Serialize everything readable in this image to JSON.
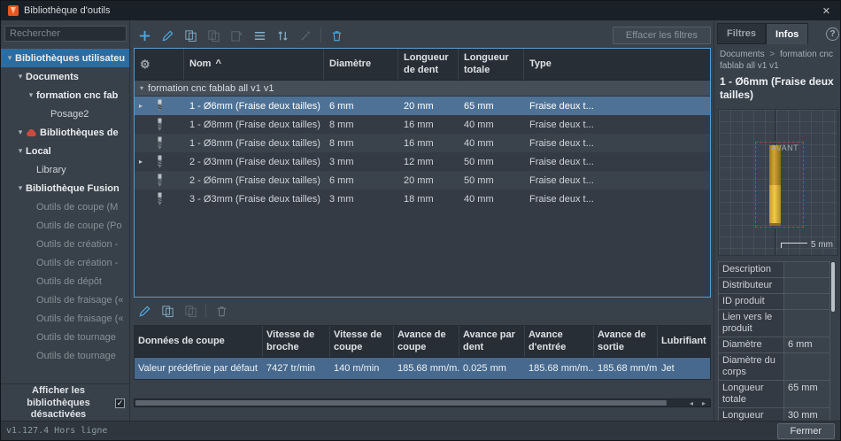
{
  "window": {
    "title": "Bibliothèque d'outils",
    "version": "v1.127.4 Hors ligne",
    "close_button": "Fermer"
  },
  "glyphs": {
    "close": "✕",
    "chevron_down": "▾",
    "chevron_right": "▸",
    "caret_up": "^",
    "gear": "⚙",
    "check": "✓",
    "arrow_left": "◂",
    "arrow_right": "▸",
    "help": "?"
  },
  "colors": {
    "accent_blue": "#4fa8e0",
    "selection_blue": "#4e7296",
    "tree_selection": "#2a6da3",
    "error_red": "#cf4a3e",
    "tool_gold": "#e8bf45",
    "brand_orange": "#e8561e"
  },
  "sidebar": {
    "search_placeholder": "Rechercher",
    "tree": [
      {
        "label": "Bibliothèques utilisateu"
      },
      {
        "label": "Documents"
      },
      {
        "label": "formation cnc fab"
      },
      {
        "label": "Posage2"
      },
      {
        "label": "Bibliothèques de"
      },
      {
        "label": "Local"
      },
      {
        "label": "Library"
      },
      {
        "label": "Bibliothèque Fusion"
      },
      {
        "label": "Outils de coupe (M"
      },
      {
        "label": "Outils de coupe (Po"
      },
      {
        "label": "Outils de création -"
      },
      {
        "label": "Outils de création -"
      },
      {
        "label": "Outils de dépôt"
      },
      {
        "label": "Outils de fraisage («"
      },
      {
        "label": "Outils de fraisage («"
      },
      {
        "label": "Outils de tournage"
      },
      {
        "label": "Outils de tournage"
      }
    ],
    "footer_label": "Afficher les bibliothèques désactivées"
  },
  "toolbar": {
    "clear_filters_label": "Effacer les filtres"
  },
  "tool_table": {
    "columns": {
      "name": "Nom",
      "diameter": "Diamètre",
      "flute_length": "Longueur de dent",
      "overall_length": "Longueur totale",
      "type": "Type"
    },
    "group_label": "formation cnc fablab all v1 v1",
    "rows": [
      {
        "name": "1 - Ø6mm (Fraise deux tailles)",
        "diameter": "6 mm",
        "flute_length": "20 mm",
        "overall_length": "65 mm",
        "type": "Fraise deux t..."
      },
      {
        "name": "1 - Ø8mm (Fraise deux tailles)",
        "diameter": "8 mm",
        "flute_length": "16 mm",
        "overall_length": "40 mm",
        "type": "Fraise deux t..."
      },
      {
        "name": "1 - Ø8mm (Fraise deux tailles)",
        "diameter": "8 mm",
        "flute_length": "16 mm",
        "overall_length": "40 mm",
        "type": "Fraise deux t..."
      },
      {
        "name": "2 - Ø3mm (Fraise deux tailles)",
        "diameter": "3 mm",
        "flute_length": "12 mm",
        "overall_length": "50 mm",
        "type": "Fraise deux t..."
      },
      {
        "name": "2 - Ø6mm (Fraise deux tailles)",
        "diameter": "6 mm",
        "flute_length": "20 mm",
        "overall_length": "50 mm",
        "type": "Fraise deux t..."
      },
      {
        "name": "3 - Ø3mm (Fraise deux tailles)",
        "diameter": "3 mm",
        "flute_length": "18 mm",
        "overall_length": "40 mm",
        "type": "Fraise deux t..."
      }
    ]
  },
  "cut_table": {
    "columns": {
      "preset": "Données de coupe",
      "spindle_speed": "Vitesse de broche",
      "cutting_speed": "Vitesse de coupe",
      "cutting_feed": "Avance de coupe",
      "feed_per_tooth": "Avance par dent",
      "lead_in_feed": "Avance d'entrée",
      "lead_out_feed": "Avance de sortie",
      "coolant": "Lubrifiant"
    },
    "rows": [
      {
        "preset": "Valeur prédéfinie par défaut",
        "spindle_speed": "7427 tr/min",
        "cutting_speed": "140 m/min",
        "cutting_feed": "185.68 mm/m...",
        "feed_per_tooth": "0.025 mm",
        "lead_in_feed": "185.68 mm/m...",
        "lead_out_feed": "185.68 mm/m...",
        "coolant": "Jet"
      }
    ]
  },
  "info_panel": {
    "tab_filters": "Filtres",
    "tab_infos": "Infos",
    "breadcrumb_root": "Documents",
    "breadcrumb_sep": ">",
    "breadcrumb_leaf": "formation cnc fablab all v1 v1",
    "title": "1 - Ø6mm (Fraise deux tailles)",
    "viewport": {
      "front_label": "AVANT",
      "scale_label": "5 mm"
    },
    "properties": [
      {
        "label": "Description",
        "value": ""
      },
      {
        "label": "Distributeur",
        "value": ""
      },
      {
        "label": "ID produit",
        "value": ""
      },
      {
        "label": "Lien vers le produit",
        "value": ""
      },
      {
        "label": "Diamètre",
        "value": "6 mm"
      },
      {
        "label": "Diamètre du corps",
        "value": ""
      },
      {
        "label": "Longueur totale",
        "value": "65 mm"
      },
      {
        "label": "Longueur",
        "value": "30 mm"
      }
    ]
  }
}
